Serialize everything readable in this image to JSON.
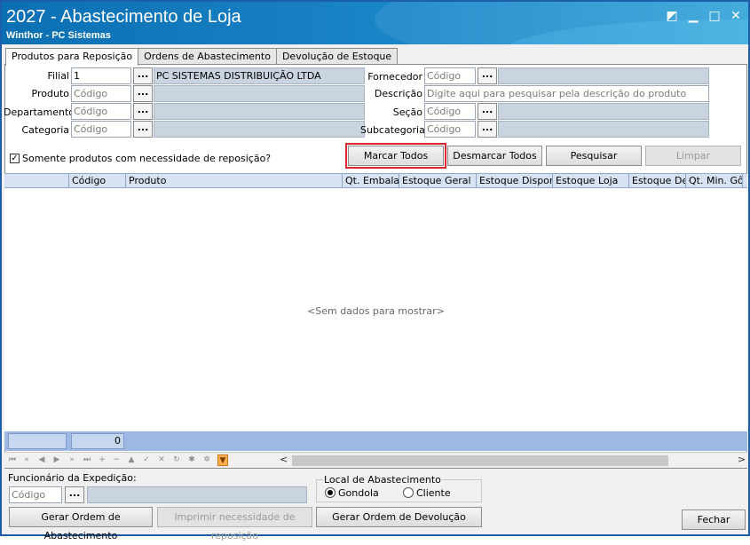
{
  "window": {
    "title": "2027 - Abastecimento de Loja",
    "subtitle": "Winthor - PC Sistemas"
  },
  "tabs": [
    {
      "label": "Produtos para Reposição",
      "active": true
    },
    {
      "label": "Ordens de Abastecimento",
      "active": false
    },
    {
      "label": "Devolução de Estoque",
      "active": false
    }
  ],
  "filters": {
    "filial": {
      "label": "Filial",
      "value": "1",
      "description": "PC SISTEMAS DISTRIBUIÇÃO LTDA"
    },
    "produto": {
      "label": "Produto",
      "placeholder": "Código"
    },
    "departamento": {
      "label": "Departamento",
      "placeholder": "Código"
    },
    "categoria": {
      "label": "Categoria",
      "placeholder": "Código"
    },
    "fornecedor": {
      "label": "Fornecedor",
      "placeholder": "Código"
    },
    "descricao": {
      "label": "Descrição",
      "placeholder": "Digite aqui para pesquisar pela descrição do produto"
    },
    "secao": {
      "label": "Seção",
      "placeholder": "Código"
    },
    "subcategoria": {
      "label": "Subcategoria",
      "placeholder": "Código"
    },
    "lookup_button": "...",
    "somente_necessidade": {
      "label": "Somente produtos com necessidade de reposição?",
      "checked": true
    }
  },
  "actions": {
    "marcar_todos": "Marcar Todos",
    "desmarcar_todos": "Desmarcar Todos",
    "pesquisar": "Pesquisar",
    "limpar": "Limpar"
  },
  "grid": {
    "columns": [
      "Código",
      "Produto",
      "Qt. Embalag",
      "Estoque Geral",
      "Estoque Disponív",
      "Estoque Loja",
      "Estoque Dep",
      "Qt. Min. Gôr"
    ],
    "empty_message": "<Sem dados para mostrar>",
    "footer_count": "0"
  },
  "bottom": {
    "funcionario_label": "Funcionário da Expedição:",
    "funcionario_placeholder": "Código",
    "local_label": "Local de Abastecimento",
    "radio_gondola": "Gondola",
    "radio_cliente": "Cliente",
    "selected_local": "Gondola",
    "gerar_ordem_abastecimento": "Gerar Ordem de Abastecimento",
    "imprimir_necessidade": "Imprimir necessidade de reposição",
    "gerar_ordem_devolucao": "Gerar Ordem de Devolução",
    "fechar": "Fechar"
  },
  "colors": {
    "titlebar": "#1a86c8",
    "highlight_outline": "#d9282f",
    "readonly_field": "#c9d4e1",
    "grid_header": "#d7e3f3",
    "footer_bar": "#9db8e2"
  }
}
